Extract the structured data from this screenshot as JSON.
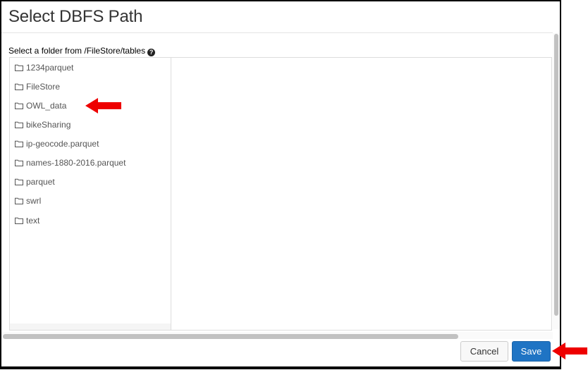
{
  "dialog": {
    "title": "Select DBFS Path",
    "section_label": "Select a folder from /FileStore/tables",
    "help_glyph": "?"
  },
  "tree": {
    "items": [
      {
        "label": "1234parquet",
        "icon": "folder-outline-icon"
      },
      {
        "label": "FileStore",
        "icon": "folder-outline-icon"
      },
      {
        "label": "OWL_data",
        "icon": "folder-outline-icon"
      },
      {
        "label": "bikeSharing",
        "icon": "folder-outline-icon"
      },
      {
        "label": "ip-geocode.parquet",
        "icon": "folder-outline-icon"
      },
      {
        "label": "names-1880-2016.parquet",
        "icon": "folder-outline-icon"
      },
      {
        "label": "parquet",
        "icon": "folder-outline-icon"
      },
      {
        "label": "swrl",
        "icon": "folder-outline-icon"
      },
      {
        "label": "text",
        "icon": "folder-outline-icon"
      }
    ]
  },
  "footer": {
    "cancel_label": "Cancel",
    "save_label": "Save"
  },
  "colors": {
    "save_bg": "#1f74c4",
    "annotation_arrow": "#ee0000"
  }
}
